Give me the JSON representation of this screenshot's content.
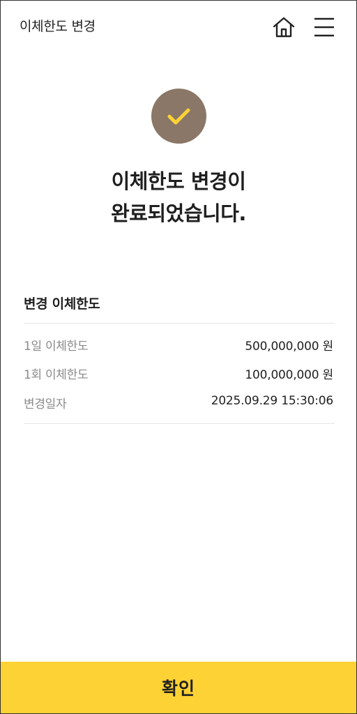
{
  "header": {
    "title": "이체한도 변경",
    "home_icon": "home-icon",
    "menu_icon": "hamburger-menu-icon"
  },
  "result": {
    "icon": "check-icon",
    "message_line1": "이체한도 변경이",
    "message_line2": "완료되었습니다.",
    "icon_bg_color": "#8b7767",
    "check_color": "#fdd235"
  },
  "details": {
    "title": "변경 이체한도",
    "rows": [
      {
        "label": "1일 이체한도",
        "value": "500,000,000 원"
      },
      {
        "label": "1회 이체한도",
        "value": "100,000,000 원"
      },
      {
        "label": "변경일자",
        "value": "2025.09.29 15:30:06"
      }
    ]
  },
  "footer": {
    "confirm_label": "확인",
    "button_color": "#fdd235"
  }
}
